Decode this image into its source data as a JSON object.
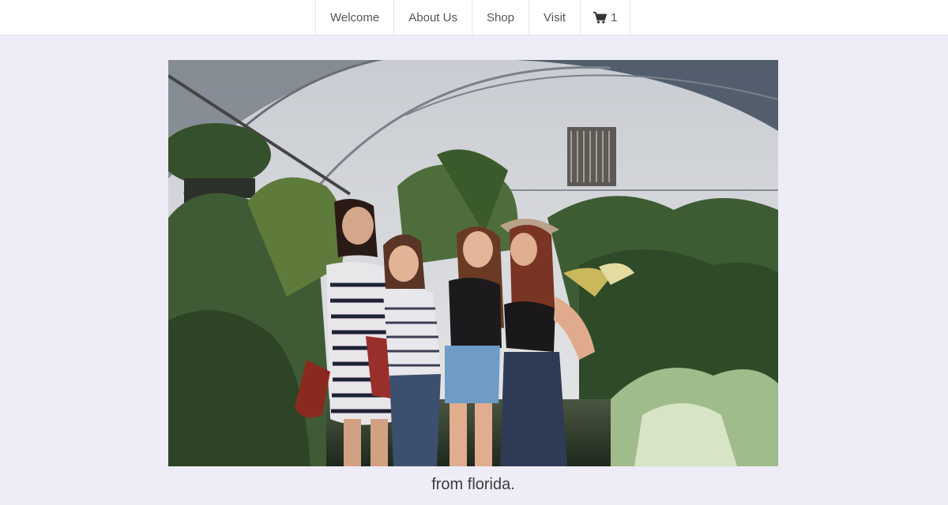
{
  "nav": {
    "items": [
      {
        "label": "Welcome"
      },
      {
        "label": "About Us"
      },
      {
        "label": "Shop"
      },
      {
        "label": "Visit"
      }
    ],
    "cart": {
      "icon": "shopping-cart-icon",
      "count": "1"
    }
  },
  "hero": {
    "alt": "Four women laughing together inside a greenhouse full of plants"
  },
  "caption": "from florida.",
  "colors": {
    "page_background": "#eeecf7",
    "navbar_background": "#ffffff",
    "nav_text": "#555555"
  }
}
